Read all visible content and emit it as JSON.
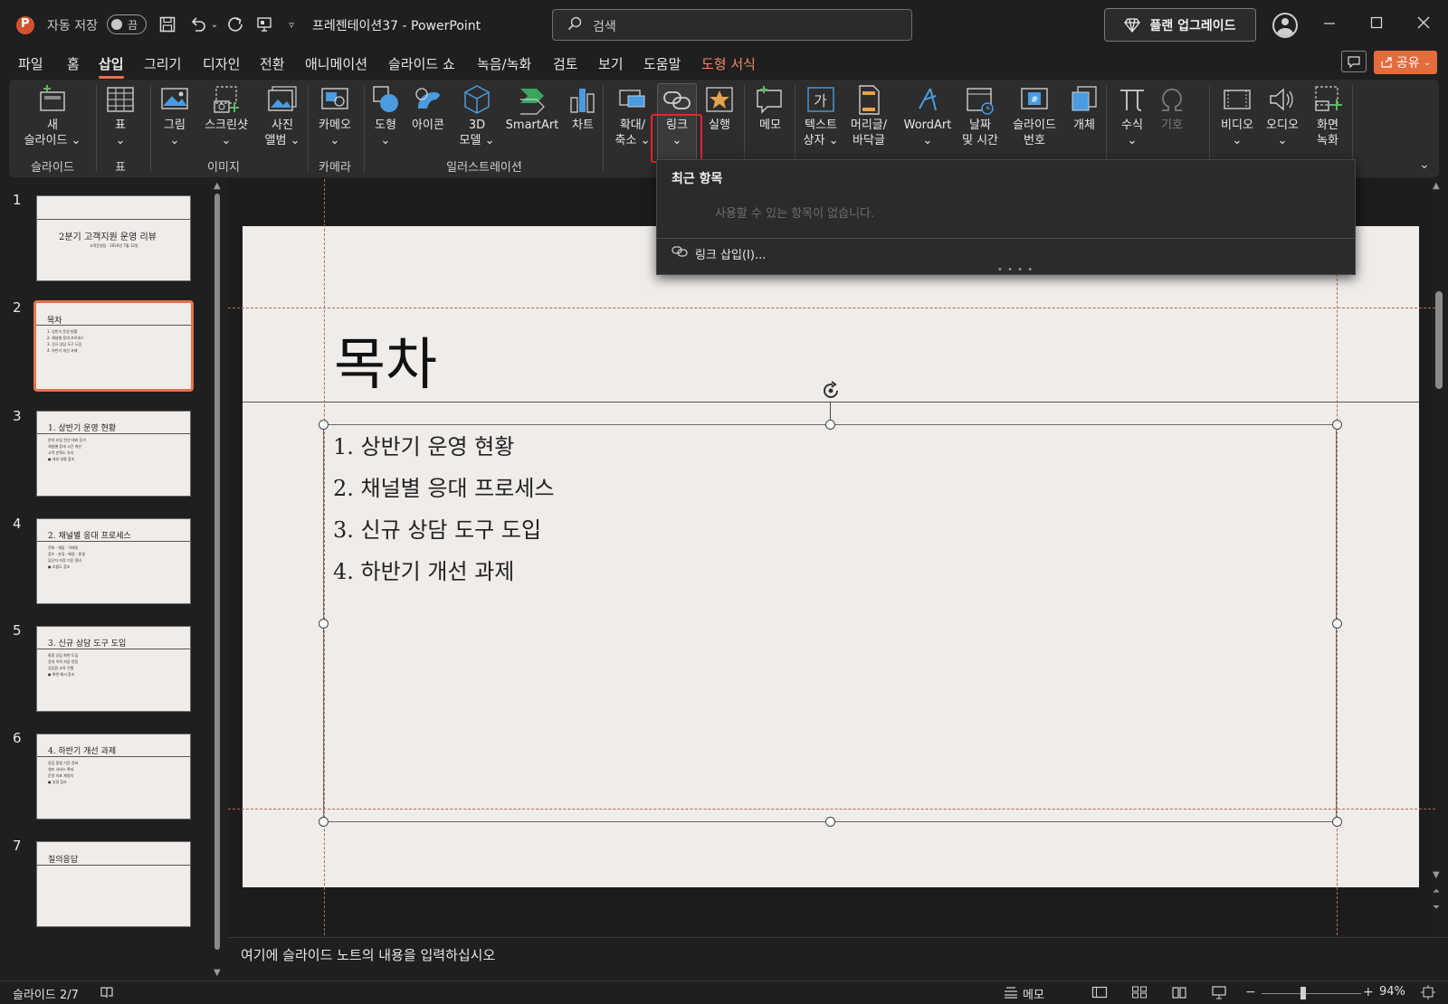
{
  "app": {
    "autosave_label": "자동 저장",
    "autosave_state": "끔",
    "document_title": "프레젠테이션37  -  PowerPoint",
    "search_placeholder": "검색",
    "upgrade_label": "플랜 업그레이드"
  },
  "tabs": [
    {
      "label": "파일"
    },
    {
      "label": "홈"
    },
    {
      "label": "삽입"
    },
    {
      "label": "그리기"
    },
    {
      "label": "디자인"
    },
    {
      "label": "전환"
    },
    {
      "label": "애니메이션"
    },
    {
      "label": "슬라이드 쇼"
    },
    {
      "label": "녹음/녹화"
    },
    {
      "label": "검토"
    },
    {
      "label": "보기"
    },
    {
      "label": "도움말"
    },
    {
      "label": "도형 서식"
    }
  ],
  "share_label": "공유",
  "ribbon": {
    "groups": [
      {
        "label": "슬라이드"
      },
      {
        "label": "표"
      },
      {
        "label": "이미지"
      },
      {
        "label": "카메라"
      },
      {
        "label": "일러스트레이션"
      }
    ],
    "buttons": {
      "new_slide": "새\n슬라이드 ⌄",
      "table": "표\n⌄",
      "picture": "그림\n⌄",
      "screenshot": "스크린샷\n⌄",
      "photo_album": "사진\n앨범 ⌄",
      "cameo": "카메오\n⌄",
      "shapes": "도형\n⌄",
      "icons": "아이콘",
      "models_3d": "3D\n모델 ⌄",
      "smartart": "SmartArt",
      "chart": "차트",
      "zoom": "확대/\n축소 ⌄",
      "link": "링크\n⌄",
      "action": "실행",
      "comment": "메모",
      "textbox": "텍스트\n상자 ⌄",
      "header_footer": "머리글/\n바닥글",
      "wordart": "WordArt\n⌄",
      "date_time": "날짜\n및 시간",
      "slide_number": "슬라이드\n번호",
      "object": "개체",
      "equation": "수식\n⌄",
      "symbol": "기호",
      "video": "비디오\n⌄",
      "audio": "오디오\n⌄",
      "screen_recording": "화면\n녹화"
    }
  },
  "link_dropdown": {
    "header": "최근 항목",
    "empty_message": "사용할 수 있는 항목이 없습니다.",
    "insert_link": "링크 삽입(I)..."
  },
  "slides": [
    {
      "num": "1",
      "title": "2분기 고객지원 운영 리뷰",
      "body": "고객운영팀 · 2024년 7월 12일"
    },
    {
      "num": "2",
      "title": "목차",
      "body": "1. 상반기 운영 현황\n2. 채널별 응대 프로세스\n3. 신규 상담 도구 도입\n4. 하반기 개선 과제"
    },
    {
      "num": "3",
      "title": "1. 상반기 운영 현황",
      "body": "문의 유입 전년 대비 증가\n채널별 응대 시간 개선\n고객 만족도 유지\n● 세부 내용 참조"
    },
    {
      "num": "4",
      "title": "2. 채널별 응대 프로세스",
      "body": "전화 · 채팅 · 이메일\n접수 · 분류 · 배정 · 종결\n담당자 지정 기준 정비\n● 흐름도 참조"
    },
    {
      "num": "5",
      "title": "3. 신규 상담 도구 도입",
      "body": "통합 상담 화면 도입\n응대 이력 자동 연동\n상담원 교육 진행\n● 화면 예시 참조"
    },
    {
      "num": "6",
      "title": "4. 하반기 개선 과제",
      "body": "응답 품질 기준 정비\n셀프 서비스 확대\n운영 지표 재정의\n● 일정 참조"
    },
    {
      "num": "7",
      "title": "질의응답",
      "body": ""
    }
  ],
  "current_slide": {
    "title": "목차",
    "bullets": [
      "1. 상반기 운영 현황",
      "2. 채널별 응대 프로세스",
      "3. 신규 상담 도구 도입",
      "4. 하반기 개선 과제"
    ]
  },
  "notes_placeholder": "여기에 슬라이드 노트의 내용을 입력하십시오",
  "status": {
    "slide_indicator": "슬라이드 2/7",
    "notes_label": "메모",
    "zoom": "94%"
  },
  "colors": {
    "accent": "#e8704e",
    "link_highlight": "#e0262e",
    "share": "#e46c3c"
  }
}
